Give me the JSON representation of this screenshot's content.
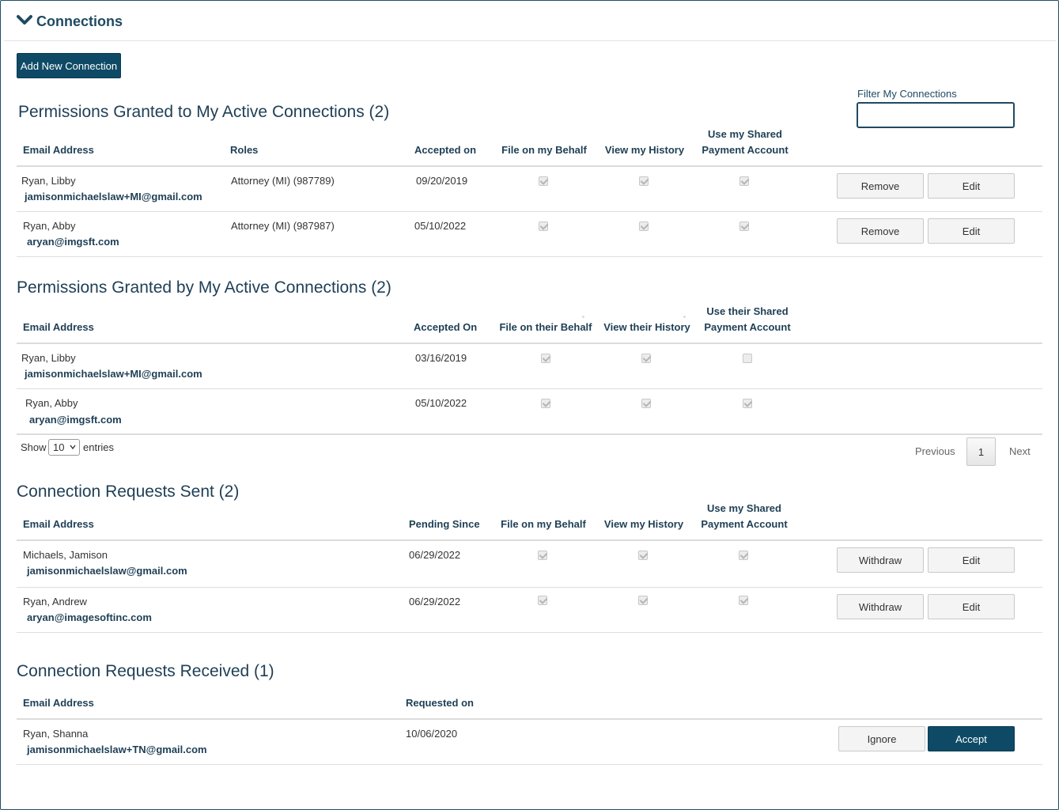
{
  "header": {
    "title": "Connections",
    "toggle_icon": "chevron-down-icon"
  },
  "add_button": "Add New Connection",
  "filter": {
    "label": "Filter My Connections",
    "value": "",
    "placeholder": ""
  },
  "granted_to": {
    "title": "Permissions Granted to My Active Connections (2)",
    "headers": {
      "email": "Email Address",
      "roles": "Roles",
      "accepted": "Accepted on",
      "file": "File on my Behalf",
      "history": "View my History",
      "shared1": "Use my Shared",
      "shared2": "Payment Account"
    },
    "rows": [
      {
        "name": "Ryan, Libby",
        "email": "jamisonmichaelslaw+MI@gmail.com",
        "role": "Attorney (MI) (987789)",
        "date": "09/20/2019",
        "file": true,
        "history": true,
        "shared": true,
        "remove": "Remove",
        "edit": "Edit"
      },
      {
        "name": "Ryan, Abby",
        "email": "aryan@imgsft.com",
        "role": "Attorney (MI) (987987)",
        "date": "05/10/2022",
        "file": true,
        "history": true,
        "shared": true,
        "remove": "Remove",
        "edit": "Edit"
      }
    ]
  },
  "granted_by": {
    "title": "Permissions Granted by My Active Connections (2)",
    "headers": {
      "email": "Email Address",
      "accepted": "Accepted On",
      "file": "File on their Behalf",
      "history": "View their History",
      "shared1": "Use their Shared",
      "shared2": "Payment Account"
    },
    "rows": [
      {
        "name": "Ryan, Libby",
        "email": "jamisonmichaelslaw+MI@gmail.com",
        "date": "03/16/2019",
        "file": true,
        "history": true,
        "shared": false
      },
      {
        "name": "Ryan, Abby",
        "email": "aryan@imgsft.com",
        "date": "05/10/2022",
        "file": true,
        "history": true,
        "shared": true
      }
    ]
  },
  "pagination": {
    "show": "Show",
    "entries_value": "10",
    "entries": "entries",
    "previous": "Previous",
    "page": "1",
    "next": "Next"
  },
  "sent": {
    "title": "Connection Requests Sent (2)",
    "headers": {
      "email": "Email Address",
      "pending": "Pending Since",
      "file": "File on my Behalf",
      "history": "View my History",
      "shared1": "Use my Shared",
      "shared2": "Payment Account"
    },
    "rows": [
      {
        "name": "Michaels, Jamison",
        "email": "jamisonmichaelslaw@gmail.com",
        "date": "06/29/2022",
        "file": true,
        "history": true,
        "shared": true,
        "withdraw": "Withdraw",
        "edit": "Edit"
      },
      {
        "name": "Ryan, Andrew",
        "email": "aryan@imagesoftinc.com",
        "date": "06/29/2022",
        "file": true,
        "history": true,
        "shared": true,
        "withdraw": "Withdraw",
        "edit": "Edit"
      }
    ]
  },
  "received": {
    "title": "Connection Requests Received (1)",
    "headers": {
      "email": "Email Address",
      "requested": "Requested on"
    },
    "rows": [
      {
        "name": "Ryan, Shanna",
        "email": "jamisonmichaelslaw+TN@gmail.com",
        "date": "10/06/2020",
        "ignore": "Ignore",
        "accept": "Accept"
      }
    ]
  },
  "colors": {
    "primary": "#0e4a66",
    "heading": "#1e3f55",
    "border": "#dcdcdc"
  }
}
